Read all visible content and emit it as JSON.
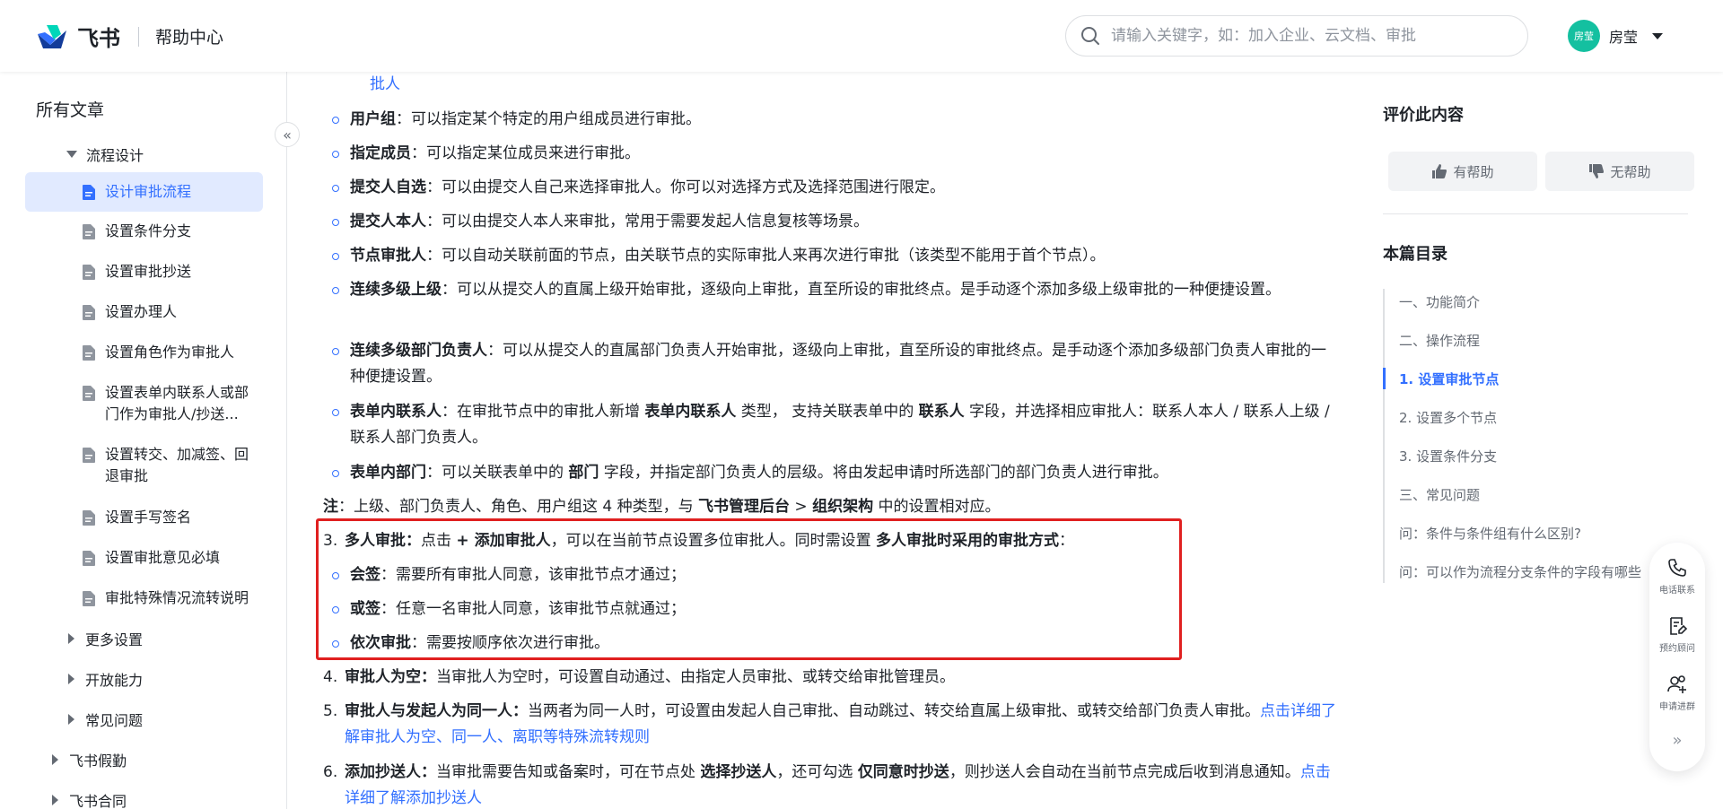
{
  "header": {
    "brand": "飞书",
    "section": "帮助中心",
    "search_placeholder": "请输入关键字，如：加入企业、云文档、审批",
    "avatar_text": "房莹",
    "user_name": "房莹"
  },
  "sidebar": {
    "all_articles": "所有文章",
    "group_open": "流程设计",
    "items": [
      "设计审批流程",
      "设置条件分支",
      "设置审批抄送",
      "设置办理人",
      "设置角色作为审批人",
      "设置表单内联系人或部门作为审批人/抄送...",
      "设置转交、加减签、回退审批",
      "设置手写签名",
      "设置审批意见必填",
      "审批特殊情况流转说明"
    ],
    "collapsed_groups": [
      "更多设置",
      "开放能力",
      "常见问题"
    ],
    "top_groups": [
      "飞书假勤",
      "飞书合同"
    ],
    "collapse_glyph": "«"
  },
  "content": {
    "top_fragment": "批人",
    "bullets": [
      {
        "term": "用户组",
        "text": "：可以指定某个特定的用户组成员进行审批。"
      },
      {
        "term": "指定成员",
        "text": "：可以指定某位成员来进行审批。"
      },
      {
        "term": "提交人自选",
        "text": "：可以由提交人自己来选择审批人。你可以对选择方式及选择范围进行限定。"
      },
      {
        "term": "提交人本人",
        "text": "：可以由提交人本人来审批，常用于需要发起人信息复核等场景。"
      },
      {
        "term": "节点审批人",
        "text": "：可以自动关联前面的节点，由关联节点的实际审批人来再次进行审批（该类型不能用于首个节点）。"
      },
      {
        "term": "连续多级上级",
        "text": "：可以从提交人的直属上级开始审批，逐级向上审批，直至所设的审批终点。是手动逐个添加多级上级审批的一种便捷设置。"
      },
      {
        "term": "连续多级部门负责人",
        "text": "：可以从提交人的直属部门负责人开始审批，逐级向上审批，直至所设的审批终点。是手动逐个添加多级部门负责人审批的一种便捷设置。"
      }
    ],
    "form_contact": {
      "term": "表单内联系人",
      "t1": "：在审批节点中的审批人新增 ",
      "b1": "表单内联系人",
      "t2": " 类型， 支持关联表单中的 ",
      "b2": "联系人",
      "t3": " 字段，并选择相应审批人：联系人本人 / 联系人上级 / 联系人部门负责人。"
    },
    "form_dept": {
      "term": "表单内部门",
      "t1": "：可以关联表单中的 ",
      "b1": "部门",
      "t2": " 字段，并指定部门负责人的层级。将由发起申请时所选部门的部门负责人进行审批。"
    },
    "note": {
      "label": "注",
      "t1": "：上级、部门负责人、角色、用户组这 4 种类型，与 ",
      "b1": "飞书管理后台",
      "t2": " > ",
      "b2": "组织架构",
      "t3": " 中的设置相对应。"
    },
    "item3": {
      "num": "3.",
      "term": "多人审批：",
      "t1": "点击 ",
      "b1": "+ 添加审批人",
      "t2": "，可以在当前节点设置多位审批人。同时需设置 ",
      "b2": "多人审批时采用的审批方式",
      "t3": "：",
      "subs": [
        {
          "term": "会签",
          "text": "：需要所有审批人同意，该审批节点才通过；"
        },
        {
          "term": "或签",
          "text": "：任意一名审批人同意，该审批节点就通过；"
        },
        {
          "term": "依次审批",
          "text": "：需要按顺序依次进行审批。"
        }
      ]
    },
    "item4": {
      "num": "4.",
      "term": "审批人为空：",
      "text": "当审批人为空时，可设置自动通过、由指定人员审批、或转交给审批管理员。"
    },
    "item5": {
      "num": "5.",
      "term": "审批人与发起人为同一人：",
      "text": "当两者为同一人时，可设置由发起人自己审批、自动跳过、转交给直属上级审批、或转交给部门负责人审批。",
      "link": "点击详细了解审批人为空、同一人、离职等特殊流转规则"
    },
    "item6": {
      "num": "6.",
      "term": "添加抄送人：",
      "t1": "当审批需要告知或备案时，可在节点处 ",
      "b1": "选择抄送人",
      "t2": "，还可勾选 ",
      "b2": "仅同意时抄送",
      "t3": "，则抄送人会自动在当前节点完成后收到消息通知。",
      "link": "点击详细了解添加抄送人"
    }
  },
  "right": {
    "rate_title": "评价此内容",
    "helpful": "有帮助",
    "unhelpful": "无帮助",
    "toc_title": "本篇目录",
    "toc": [
      "一、功能简介",
      "二、操作流程",
      "1. 设置审批节点",
      "2. 设置多个节点",
      "3. 设置条件分支",
      "三、常见问题",
      "问：条件与条件组有什么区别?",
      "问：可以作为流程分支条件的字段有哪些"
    ],
    "toc_active_index": 2
  },
  "float": {
    "items": [
      "电话联系",
      "预约顾问",
      "申请进群"
    ],
    "more_glyph": "»"
  },
  "colors": {
    "accent": "#3370ff",
    "highlight_border": "#e02020",
    "active_bg": "#e1eaff"
  }
}
